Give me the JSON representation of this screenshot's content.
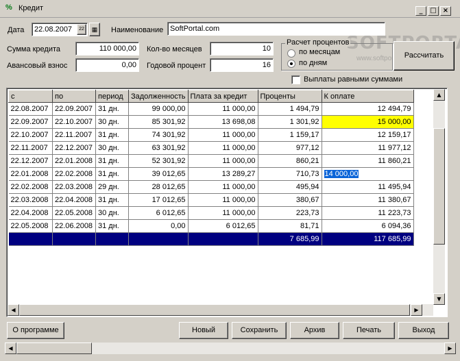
{
  "window": {
    "title": "Кредит",
    "icon": "percent-icon"
  },
  "form": {
    "date_label": "Дата",
    "date_value": "22.08.2007",
    "name_label": "Наименование",
    "name_value": "SoftPortal.com",
    "amount_label": "Сумма кредита",
    "amount_value": "110 000,00",
    "advance_label": "Авансовый взнос",
    "advance_value": "0,00",
    "months_label": "Кол-во месяцев",
    "months_value": "10",
    "rate_label": "Годовой процент",
    "rate_value": "16"
  },
  "calc": {
    "group_label": "Расчет процентов",
    "option_months": "по месяцам",
    "option_days": "по дням",
    "selected": "по дням",
    "calc_button": "Рассчитать",
    "equal_payments_label": "Выплаты равными суммами",
    "equal_payments_checked": false
  },
  "table": {
    "columns": [
      "с",
      "по",
      "период",
      "Задолженность",
      "Плата за кредит",
      "Проценты",
      "К оплате"
    ],
    "rows": [
      [
        "22.08.2007",
        "22.09.2007",
        "31 дн.",
        "99 000,00",
        "11 000,00",
        "1 494,79",
        "12 494,79"
      ],
      [
        "22.09.2007",
        "22.10.2007",
        "30 дн.",
        "85 301,92",
        "13 698,08",
        "1 301,92",
        "15 000,00"
      ],
      [
        "22.10.2007",
        "22.11.2007",
        "31 дн.",
        "74 301,92",
        "11 000,00",
        "1 159,17",
        "12 159,17"
      ],
      [
        "22.11.2007",
        "22.12.2007",
        "30 дн.",
        "63 301,92",
        "11 000,00",
        "977,12",
        "11 977,12"
      ],
      [
        "22.12.2007",
        "22.01.2008",
        "31 дн.",
        "52 301,92",
        "11 000,00",
        "860,21",
        "11 860,21"
      ],
      [
        "22.01.2008",
        "22.02.2008",
        "31 дн.",
        "39 012,65",
        "13 289,27",
        "710,73",
        "14 000,00"
      ],
      [
        "22.02.2008",
        "22.03.2008",
        "29 дн.",
        "28 012,65",
        "11 000,00",
        "495,94",
        "11 495,94"
      ],
      [
        "22.03.2008",
        "22.04.2008",
        "31 дн.",
        "17 012,65",
        "11 000,00",
        "380,67",
        "11 380,67"
      ],
      [
        "22.04.2008",
        "22.05.2008",
        "30 дн.",
        "6 012,65",
        "11 000,00",
        "223,73",
        "11 223,73"
      ],
      [
        "22.05.2008",
        "22.06.2008",
        "31 дн.",
        "0,00",
        "6 012,65",
        "81,71",
        "6 094,36"
      ]
    ],
    "total": {
      "interest": "7 685,99",
      "payment": "117 685,99"
    }
  },
  "buttons": {
    "about": "О программе",
    "new": "Новый",
    "save": "Сохранить",
    "archive": "Архив",
    "print": "Печать",
    "exit": "Выход"
  },
  "watermark": {
    "brand": "SOFTPORTAL",
    "url": "www.softportal.com"
  },
  "colors": {
    "highlight": "#ffff00",
    "total_row": "#000080",
    "selection": "#0a64d8"
  }
}
